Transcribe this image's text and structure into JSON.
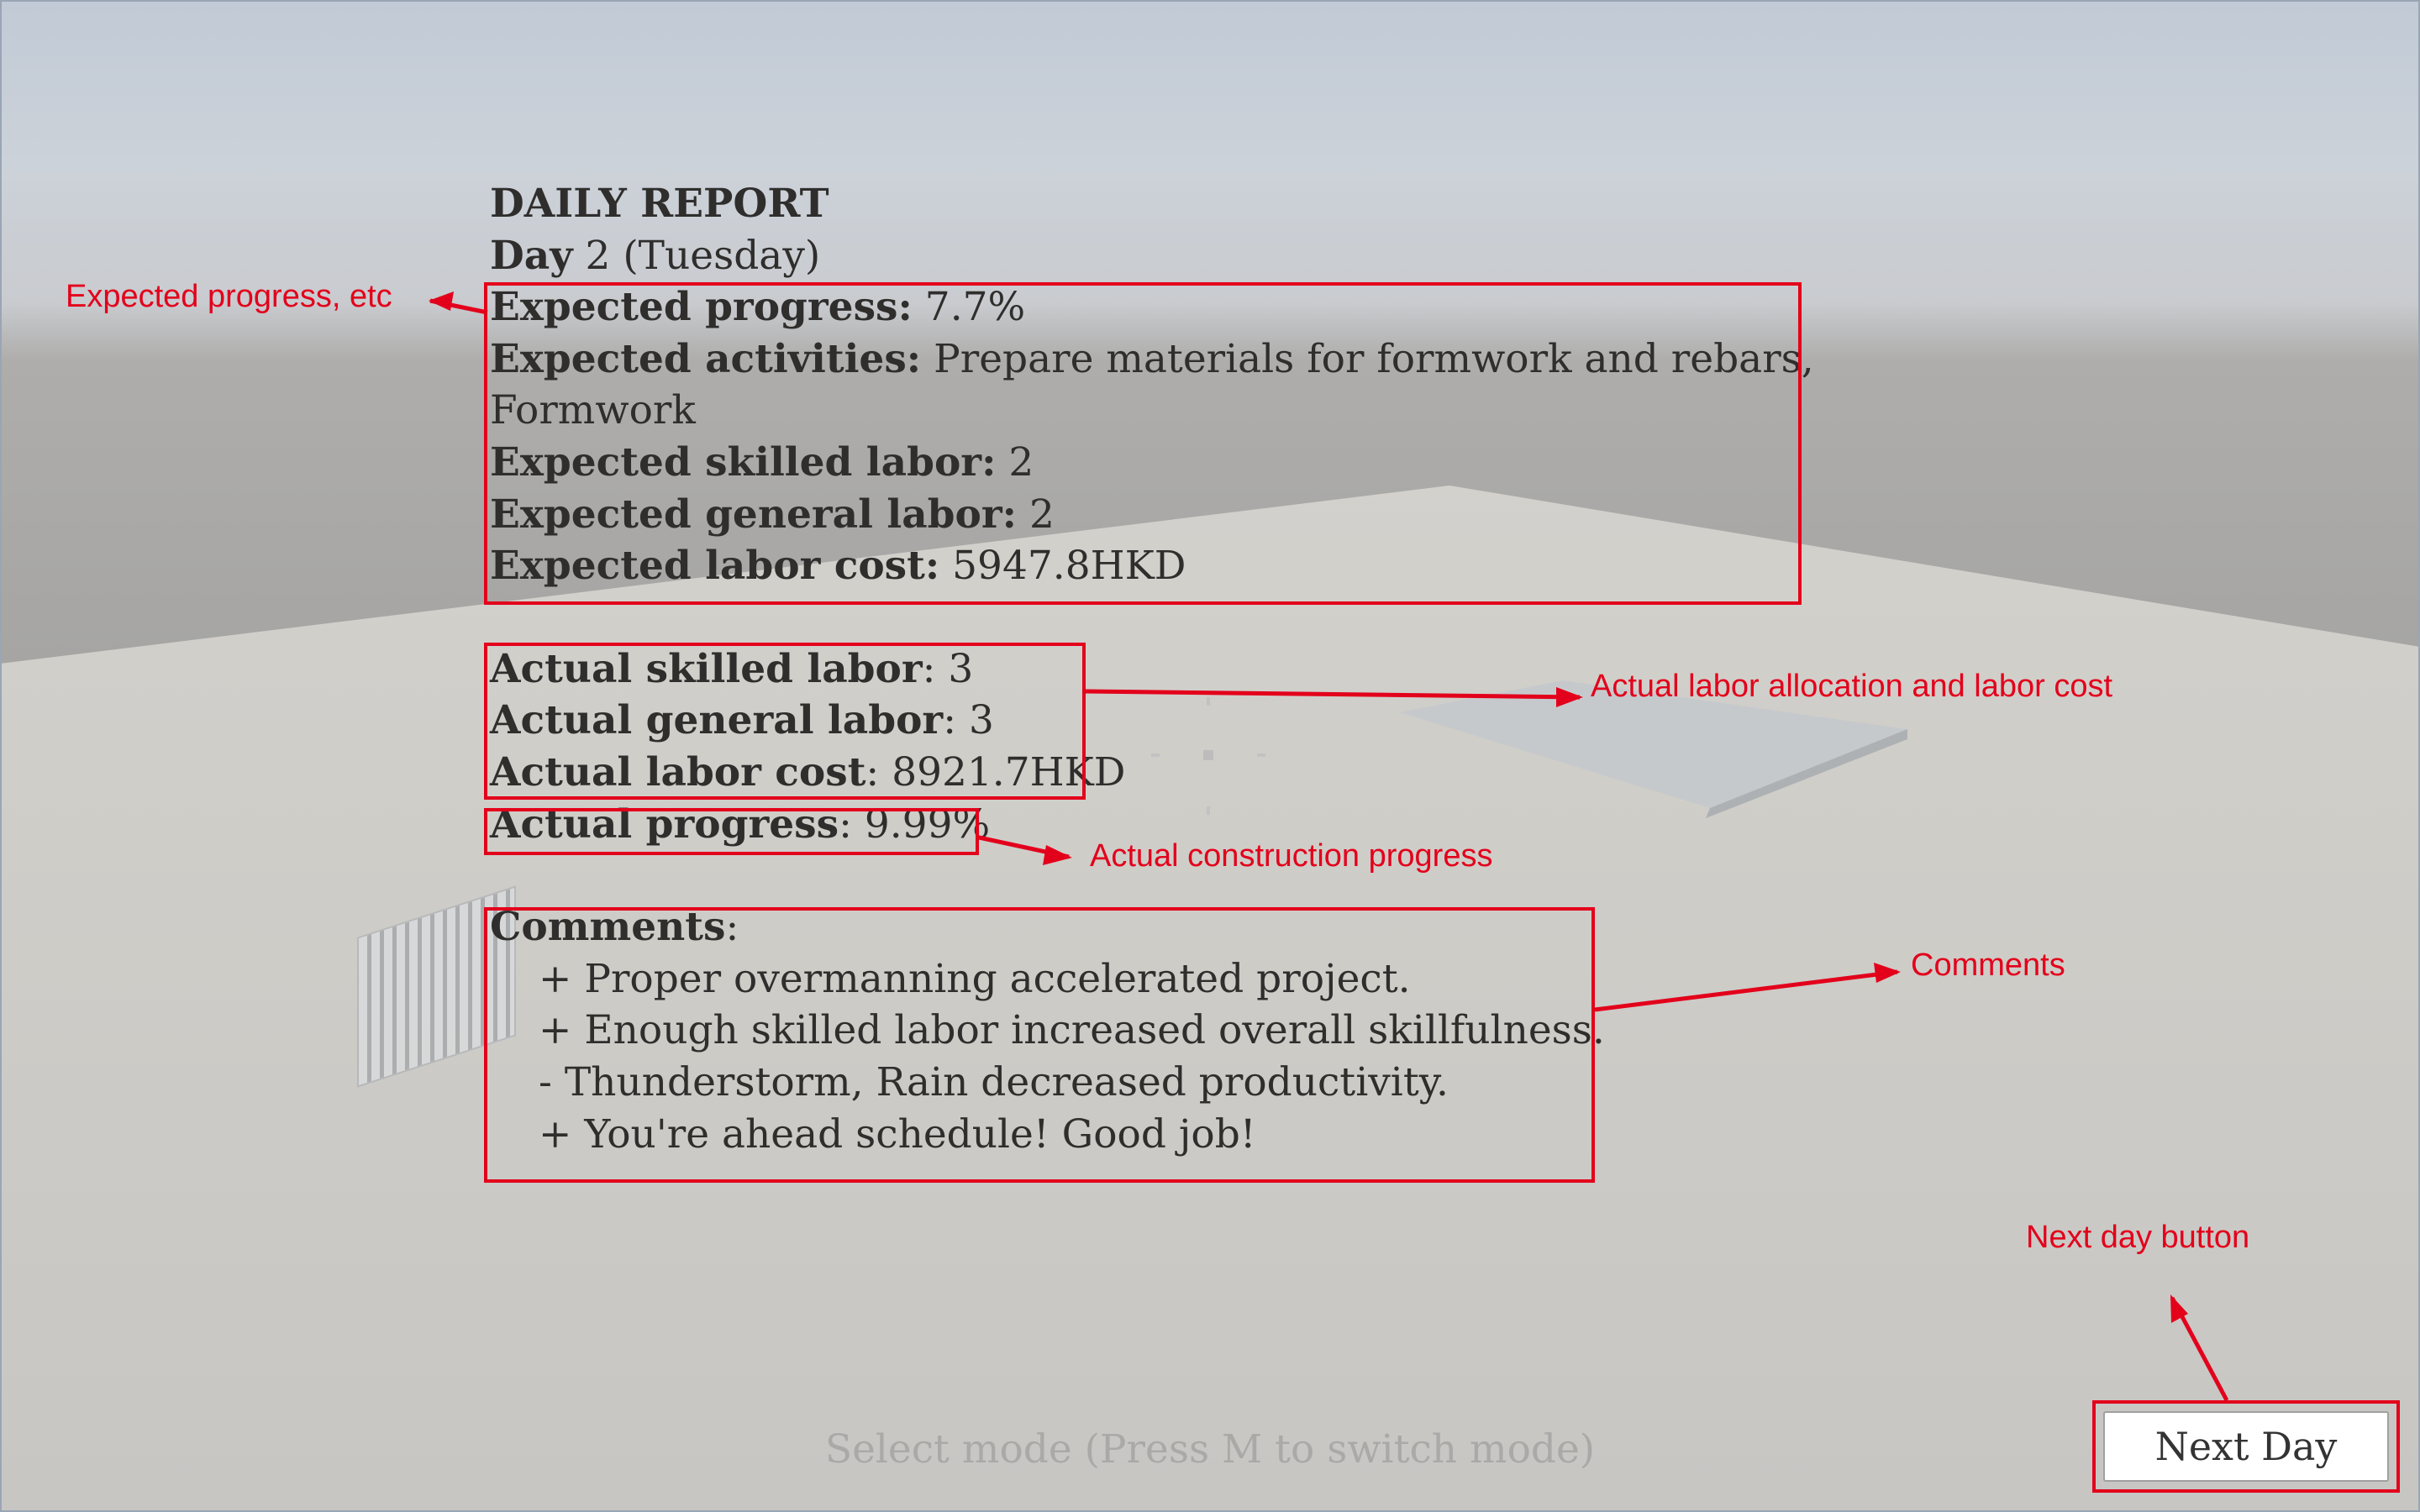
{
  "report": {
    "title": "DAILY REPORT",
    "day_label": "Day",
    "day_value": "2 (Tuesday)",
    "expected_progress_label": "Expected progress:",
    "expected_progress_value": "7.7%",
    "expected_activities_label": "Expected activities:",
    "expected_activities_value": "Prepare materials for formwork and rebars,",
    "expected_activities_value_cont": "Formwork",
    "expected_skilled_label": "Expected skilled labor:",
    "expected_skilled_value": "2",
    "expected_general_label": "Expected general labor:",
    "expected_general_value": "2",
    "expected_cost_label": "Expected labor cost:",
    "expected_cost_value": "5947.8HKD",
    "actual_skilled_label": "Actual skilled labor",
    "actual_skilled_value": ": 3",
    "actual_general_label": "Actual general labor",
    "actual_general_value": ": 3",
    "actual_cost_label": "Actual labor cost",
    "actual_cost_value": ": 8921.7HKD",
    "actual_progress_label": "Actual progress",
    "actual_progress_value": ": 9.99%",
    "comments_label": "Comments",
    "comments_colon": ":",
    "comments": [
      "+ Proper overmanning accelerated project.",
      "+ Enough skilled labor increased overall skillfulness.",
      "- Thunderstorm, Rain decreased productivity.",
      "+ You're ahead schedule! Good job!"
    ]
  },
  "mode_hint": "Select mode (Press M to switch mode)",
  "next_day_button": "Next Day",
  "annotations": {
    "expected": "Expected progress, etc",
    "actual_labor": "Actual labor allocation and labor cost",
    "actual_progress": "Actual construction progress",
    "comments": "Comments",
    "next_day": "Next day button"
  },
  "colors": {
    "annotation": "#e3001b",
    "report_text": "#2f2e2d"
  }
}
